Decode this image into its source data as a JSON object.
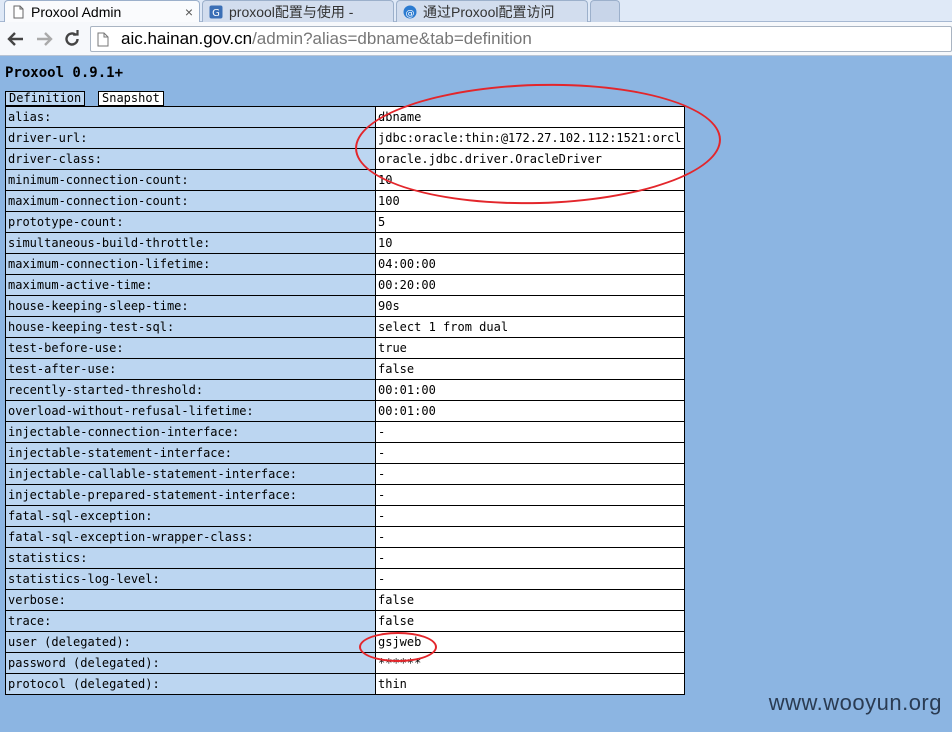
{
  "browser": {
    "tabs": [
      {
        "title": "Proxool Admin",
        "close": "×",
        "active": true
      },
      {
        "title": "proxool配置与使用 -",
        "close": "",
        "active": false
      },
      {
        "title": "通过Proxool配置访问",
        "close": "",
        "active": false
      }
    ],
    "url": {
      "host": "aic.hainan.gov.cn",
      "path": "/admin?alias=dbname&tab=definition"
    }
  },
  "page": {
    "title": "Proxool 0.9.1+",
    "tabs": [
      "Definition",
      "Snapshot"
    ],
    "selected_tab": "Definition",
    "rows": [
      {
        "key": "alias:",
        "value": "dbname"
      },
      {
        "key": "driver-url:",
        "value": "jdbc:oracle:thin:@172.27.102.112:1521:orcl"
      },
      {
        "key": "driver-class:",
        "value": "oracle.jdbc.driver.OracleDriver"
      },
      {
        "key": "minimum-connection-count:",
        "value": "10"
      },
      {
        "key": "maximum-connection-count:",
        "value": "100"
      },
      {
        "key": "prototype-count:",
        "value": "5"
      },
      {
        "key": "simultaneous-build-throttle:",
        "value": "10"
      },
      {
        "key": "maximum-connection-lifetime:",
        "value": "04:00:00"
      },
      {
        "key": "maximum-active-time:",
        "value": "00:20:00"
      },
      {
        "key": "house-keeping-sleep-time:",
        "value": "90s"
      },
      {
        "key": "house-keeping-test-sql:",
        "value": "select 1 from dual"
      },
      {
        "key": "test-before-use:",
        "value": "true"
      },
      {
        "key": "test-after-use:",
        "value": "false"
      },
      {
        "key": "recently-started-threshold:",
        "value": "00:01:00"
      },
      {
        "key": "overload-without-refusal-lifetime:",
        "value": "00:01:00"
      },
      {
        "key": "injectable-connection-interface:",
        "value": "-"
      },
      {
        "key": "injectable-statement-interface:",
        "value": "-"
      },
      {
        "key": "injectable-callable-statement-interface:",
        "value": "-"
      },
      {
        "key": "injectable-prepared-statement-interface:",
        "value": "-"
      },
      {
        "key": "fatal-sql-exception:",
        "value": "-"
      },
      {
        "key": "fatal-sql-exception-wrapper-class:",
        "value": "-"
      },
      {
        "key": "statistics:",
        "value": "-"
      },
      {
        "key": "statistics-log-level:",
        "value": "-"
      },
      {
        "key": "verbose:",
        "value": "false"
      },
      {
        "key": "trace:",
        "value": "false"
      },
      {
        "key": "user (delegated):",
        "value": "gsjweb"
      },
      {
        "key": "password (delegated):",
        "value": "******"
      },
      {
        "key": "protocol (delegated):",
        "value": "thin"
      }
    ]
  },
  "watermark": "www.wooyun.org",
  "colors": {
    "page_bg": "#8cb5e2",
    "key_cell": "#bcd6f1",
    "annotation": "#e3262b"
  }
}
